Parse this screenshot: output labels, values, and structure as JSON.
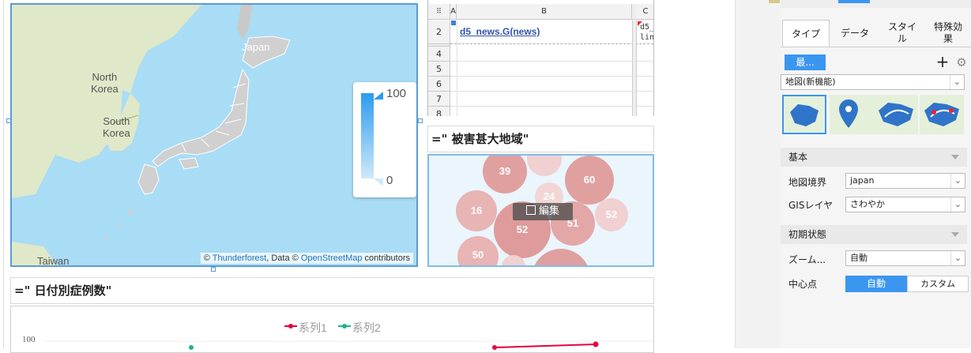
{
  "map": {
    "labels": {
      "japan": "Japan",
      "north_korea": "North\nKorea",
      "south_korea": "South\nKorea",
      "taiwan": "Taiwan"
    },
    "legend_max": "100",
    "legend_min": "0",
    "attribution": {
      "prefix": "© ",
      "provider": "Thunderforest",
      "mid": ", Data © ",
      "data_source": "OpenStreetMap",
      "suffix": " contributors"
    },
    "colors": {
      "sea": "#a9dcf5",
      "land": "#dfe8c8",
      "prefectures": "#d0d0d0",
      "border": "#5b9bd5"
    }
  },
  "sheet": {
    "columns": [
      "A",
      "B",
      "C"
    ],
    "rows": [
      "2",
      "4",
      "5",
      "6",
      "7",
      "8"
    ],
    "cell_b2": "d5_news.G(news)",
    "cell_c2": "d5_\nlin"
  },
  "sections": {
    "bubble_title": "=\" 被害甚大地域\"",
    "line_title": "=\" 日付別症例数\""
  },
  "bubble_chart": {
    "values": [
      "39",
      "60",
      "24",
      "16",
      "52",
      "51",
      "52",
      "50"
    ],
    "edit_label": "編集"
  },
  "chart_data": {
    "type": "line",
    "title": "",
    "series": [
      {
        "name": "系列1",
        "color": "#e8003c"
      },
      {
        "name": "系列2",
        "color": "#1fb28e"
      }
    ],
    "ytick_top": "100"
  },
  "panel": {
    "tabs": [
      "タイプ",
      "データ",
      "スタイ\nル",
      "特殊効\n果"
    ],
    "recent_button": "最...",
    "add_icon": "+",
    "map_type_select": "地図(新機能)",
    "section_basic": "基本",
    "map_boundary_label": "地図境界",
    "map_boundary_value": "japan",
    "gis_layer_label": "GISレイヤ",
    "gis_layer_value": "さわやか",
    "section_initial": "初期状態",
    "zoom_label": "ズーム...",
    "zoom_value": "自動",
    "center_label": "中心点",
    "center_auto": "自動",
    "center_custom": "カスタム",
    "accent_color": "#3b96f0"
  }
}
